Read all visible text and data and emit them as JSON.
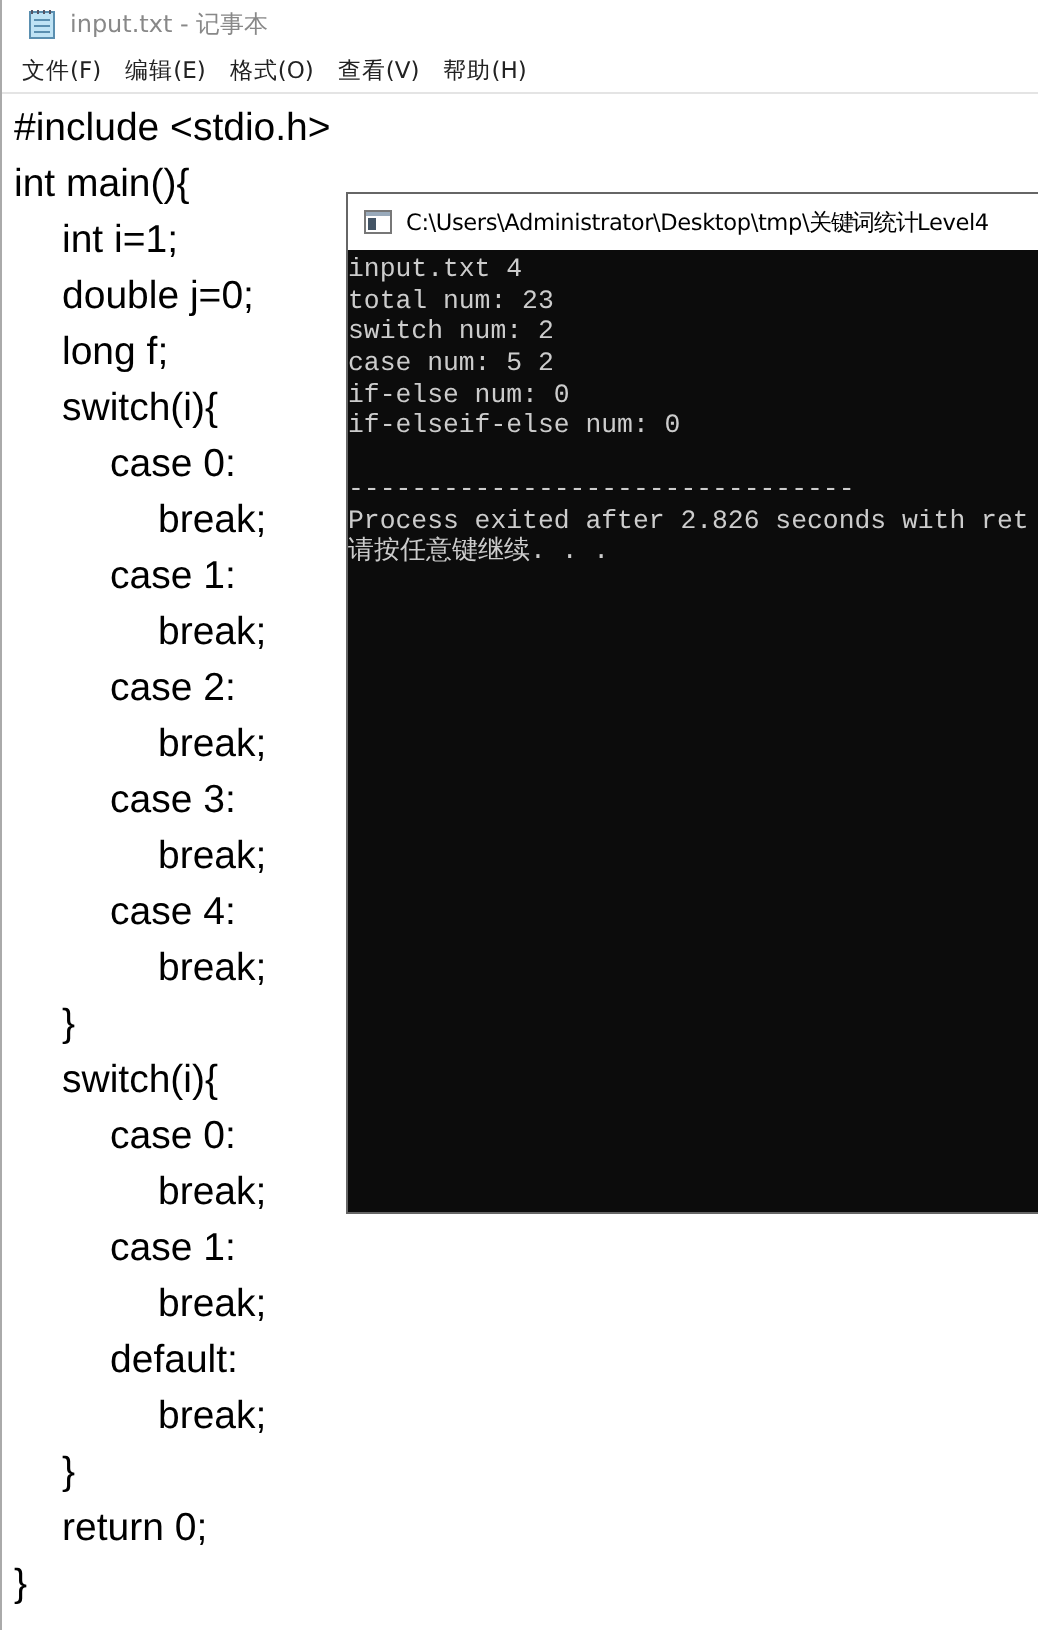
{
  "notepad": {
    "title": "input.txt - 记事本",
    "menu": [
      "文件(F)",
      "编辑(E)",
      "格式(O)",
      "查看(V)",
      "帮助(H)"
    ],
    "lines": [
      "#include <stdio.h>",
      "int main(){",
      "\tint i=1;",
      "\tdouble j=0;",
      "\tlong f;",
      "\tswitch(i){",
      "\t\tcase 0:",
      "\t\t\tbreak;",
      "\t\tcase 1:",
      "\t\t\tbreak;",
      "\t\tcase 2:",
      "\t\t\tbreak;",
      "\t\tcase 3:",
      "\t\t\tbreak;",
      "\t\tcase 4:",
      "\t\t\tbreak;",
      "\t}",
      "\tswitch(i){",
      "\t\tcase 0:",
      "\t\t\tbreak;",
      "\t\tcase 1:",
      "\t\t\tbreak;",
      "\t\tdefault:",
      "\t\t\tbreak;",
      "\t}",
      "\treturn 0;",
      "}"
    ]
  },
  "console": {
    "title": "C:\\Users\\Administrator\\Desktop\\tmp\\关键词统计Level4",
    "lines": [
      "input.txt 4",
      "total num: 23",
      "switch num: 2",
      "case num: 5 2",
      "if-else num: 0",
      "if-elseif-else num: 0"
    ],
    "separator": "--------------------------------",
    "footer": [
      "Process exited after 2.826 seconds with ret",
      "请按任意键继续. . ."
    ]
  }
}
